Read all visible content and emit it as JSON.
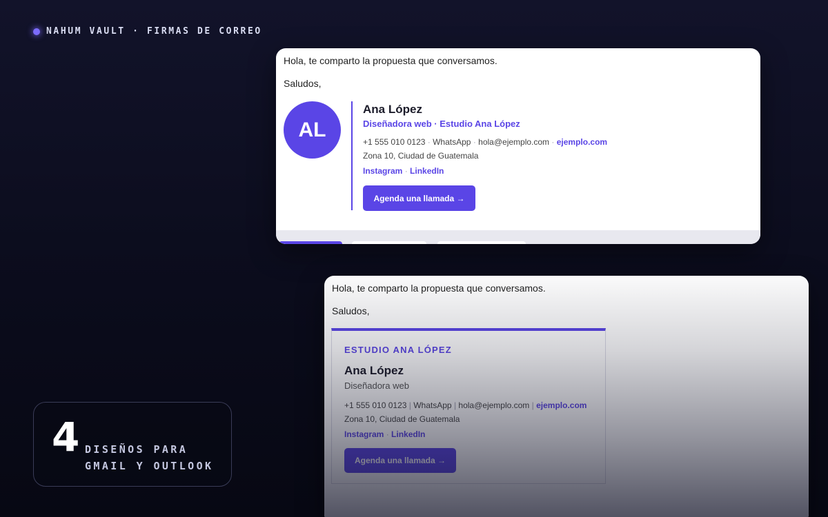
{
  "brand": {
    "text": "NAHUM VAULT · FIRMAS DE CORREO"
  },
  "email": {
    "body_line_1": "Hola, te comparto la propuesta que conversamos.",
    "body_line_2": "Saludos,"
  },
  "signature_1": {
    "avatar_initials": "AL",
    "name": "Ana López",
    "role": "Diseñadora web · Estudio Ana López",
    "phone": "+1 555 010 0123",
    "whatsapp": "WhatsApp",
    "email": "hola@ejemplo.com",
    "website": "ejemplo.com",
    "separator": "·",
    "address": "Zona 10, Ciudad de Guatemala",
    "instagram": "Instagram",
    "linkedin": "LinkedIn",
    "cta": "Agenda una llamada →"
  },
  "signature_2": {
    "studio": "ESTUDIO ANA LÓPEZ",
    "name": "Ana López",
    "role": "Diseñadora web",
    "phone": "+1 555 010 0123",
    "whatsapp": "WhatsApp",
    "email": "hola@ejemplo.com",
    "website": "ejemplo.com",
    "separator": "|",
    "address": "Zona 10, Ciudad de Guatemala",
    "instagram": "Instagram",
    "linkedin": "LinkedIn",
    "social_separator": "·",
    "cta": "Agenda una llamada →"
  },
  "badge": {
    "number": "4",
    "line_1": "DISEÑOS PARA",
    "line_2": "GMAIL Y OUTLOOK"
  },
  "colors": {
    "accent": "#5a45e6",
    "background": "#0b0c1c",
    "card": "#ffffff"
  }
}
